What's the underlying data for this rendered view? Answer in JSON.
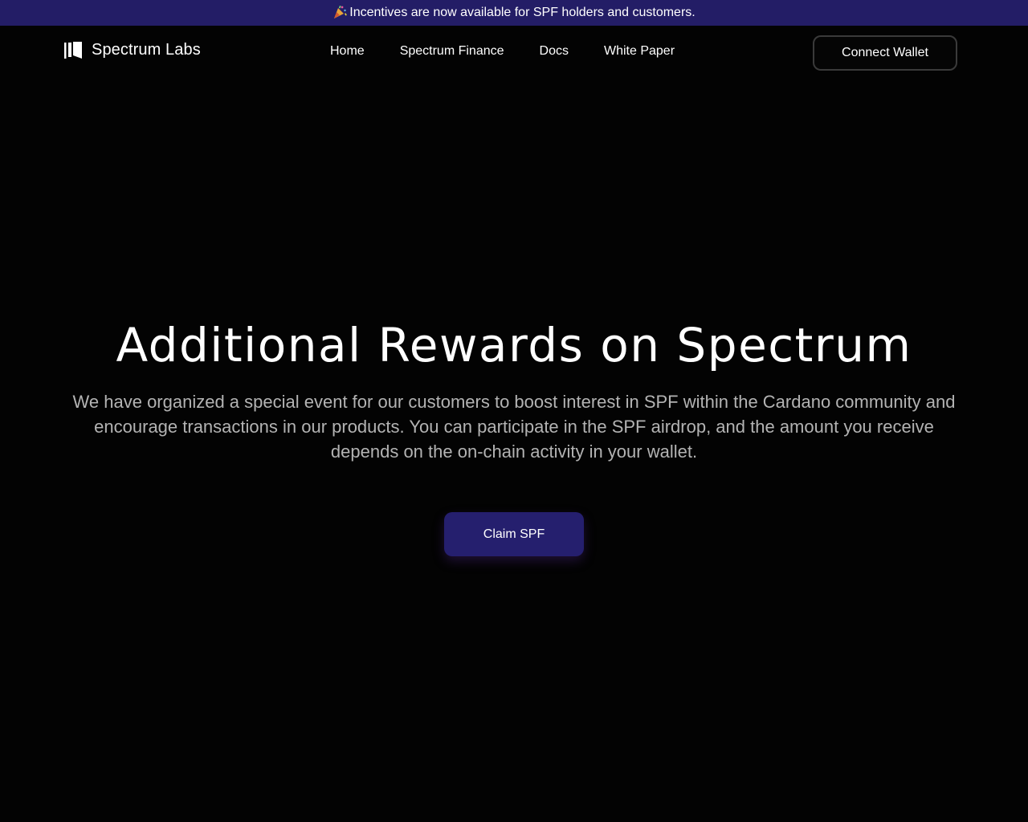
{
  "banner": {
    "icon": "party-popper-icon",
    "text": "Incentives are now available for SPF holders and customers."
  },
  "header": {
    "logo_text": "Spectrum Labs",
    "logo_icon": "spectrum-logo-icon",
    "nav": [
      {
        "label": "Home"
      },
      {
        "label": "Spectrum Finance"
      },
      {
        "label": "Docs"
      },
      {
        "label": "White Paper"
      }
    ],
    "connect_label": "Connect Wallet"
  },
  "hero": {
    "title": "Additional Rewards on Spectrum",
    "description": "We have organized a special event for our customers to boost interest in SPF within the Cardano community and encourage transactions in our products. You can participate in the SPF airdrop, and the amount you receive depends on the on-chain activity in your wallet.",
    "cta_label": "Claim SPF"
  },
  "colors": {
    "background": "#030303",
    "banner": "#231d66",
    "cta": "#251f6e",
    "muted_text": "#b3b3b3"
  }
}
